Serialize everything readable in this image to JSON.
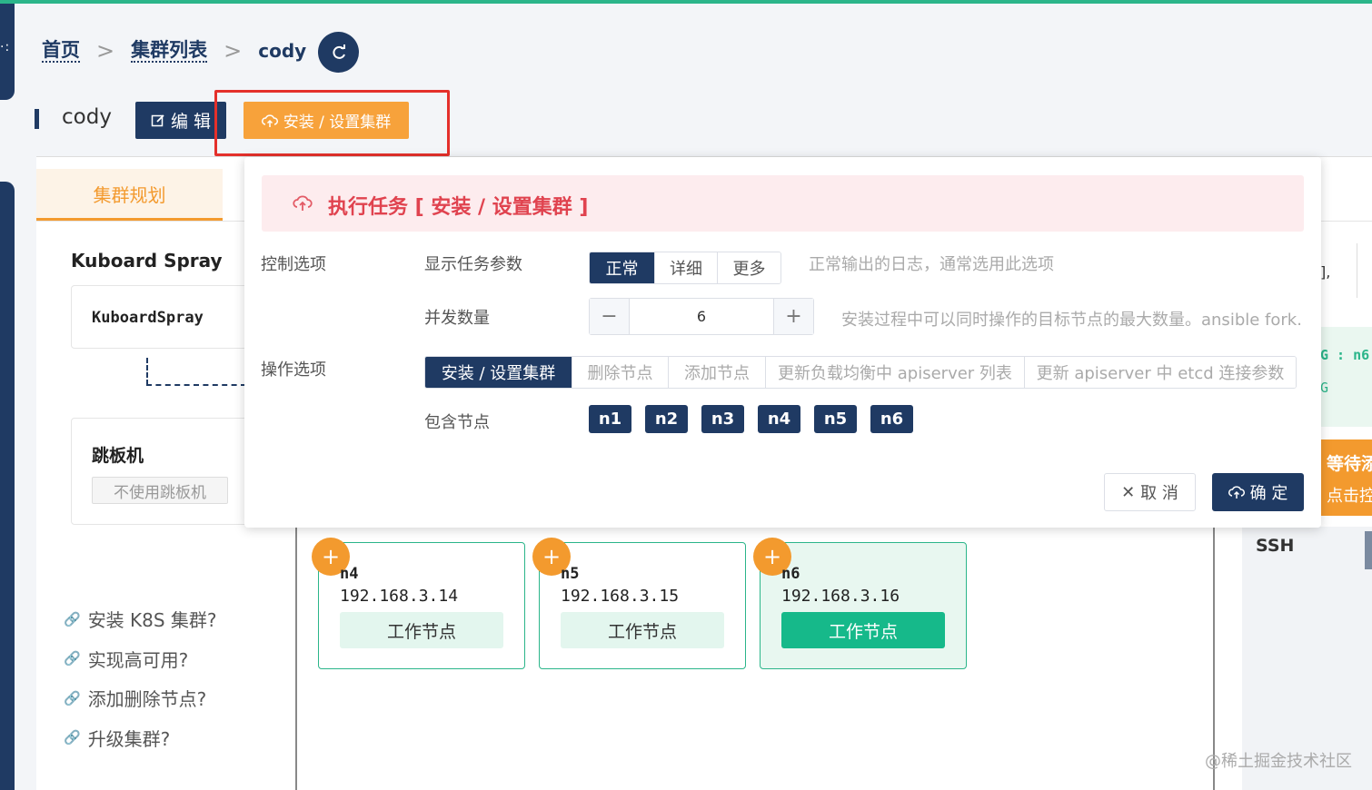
{
  "breadcrumb": {
    "home": "首页",
    "cluster_list": "集群列表",
    "current": "cody",
    "separator": ">"
  },
  "page": {
    "title": "cody"
  },
  "toolbar": {
    "edit_label": "编 辑",
    "install_label": "安装 / 设置集群"
  },
  "tabs": [
    {
      "label": "集群规划",
      "active": true
    }
  ],
  "left_panel": {
    "section_title": "Kuboard Spray",
    "card_label": "KuboardSpray",
    "jump_title": "跳板机",
    "jump_value": "不使用跳板机",
    "help_links": [
      "安装 K8S 集群?",
      "实现高可用?",
      "添加删除节点?",
      "升级集群?"
    ]
  },
  "nodes": [
    {
      "name": "n4",
      "ip": "192.168.3.14",
      "role": "工作节点",
      "active": false
    },
    {
      "name": "n5",
      "ip": "192.168.3.15",
      "role": "工作节点",
      "active": false
    },
    {
      "name": "n6",
      "ip": "192.168.3.16",
      "role": "工作节点",
      "active": true
    }
  ],
  "right_partial": {
    "bracket": "],",
    "code_line": "G : n6",
    "code_line2": "G",
    "orange_line1": "等待添",
    "orange_line2": "点击控",
    "ssh": "SSH"
  },
  "dialog": {
    "alert_title": "执行任务 [ 安装 / 设置集群 ]",
    "control_label": "控制选项",
    "show_params_label": "显示任务参数",
    "verbosity_options": [
      {
        "label": "正常",
        "selected": true
      },
      {
        "label": "详细",
        "selected": false
      },
      {
        "label": "更多",
        "selected": false
      }
    ],
    "verbosity_hint": "正常输出的日志，通常选用此选项",
    "forks_label": "并发数量",
    "forks_value": "6",
    "forks_hint": "安装过程中可以同时操作的目标节点的最大数量。ansible fork.",
    "operation_label": "操作选项",
    "operation_options": [
      {
        "label": "安装 / 设置集群",
        "selected": true
      },
      {
        "label": "删除节点",
        "selected": false
      },
      {
        "label": "添加节点",
        "selected": false
      },
      {
        "label": "更新负载均衡中 apiserver 列表",
        "selected": false
      },
      {
        "label": "更新 apiserver 中 etcd 连接参数",
        "selected": false
      }
    ],
    "include_nodes_label": "包含节点",
    "include_nodes": [
      "n1",
      "n2",
      "n3",
      "n4",
      "n5",
      "n6"
    ],
    "cancel_label": "取 消",
    "confirm_label": "确 定"
  },
  "watermark": "@稀土掘金技术社区",
  "colors": {
    "primary": "#1f3a63",
    "accent_orange": "#f7a23b",
    "success_green": "#16b98a",
    "alert_red": "#e0434f"
  }
}
